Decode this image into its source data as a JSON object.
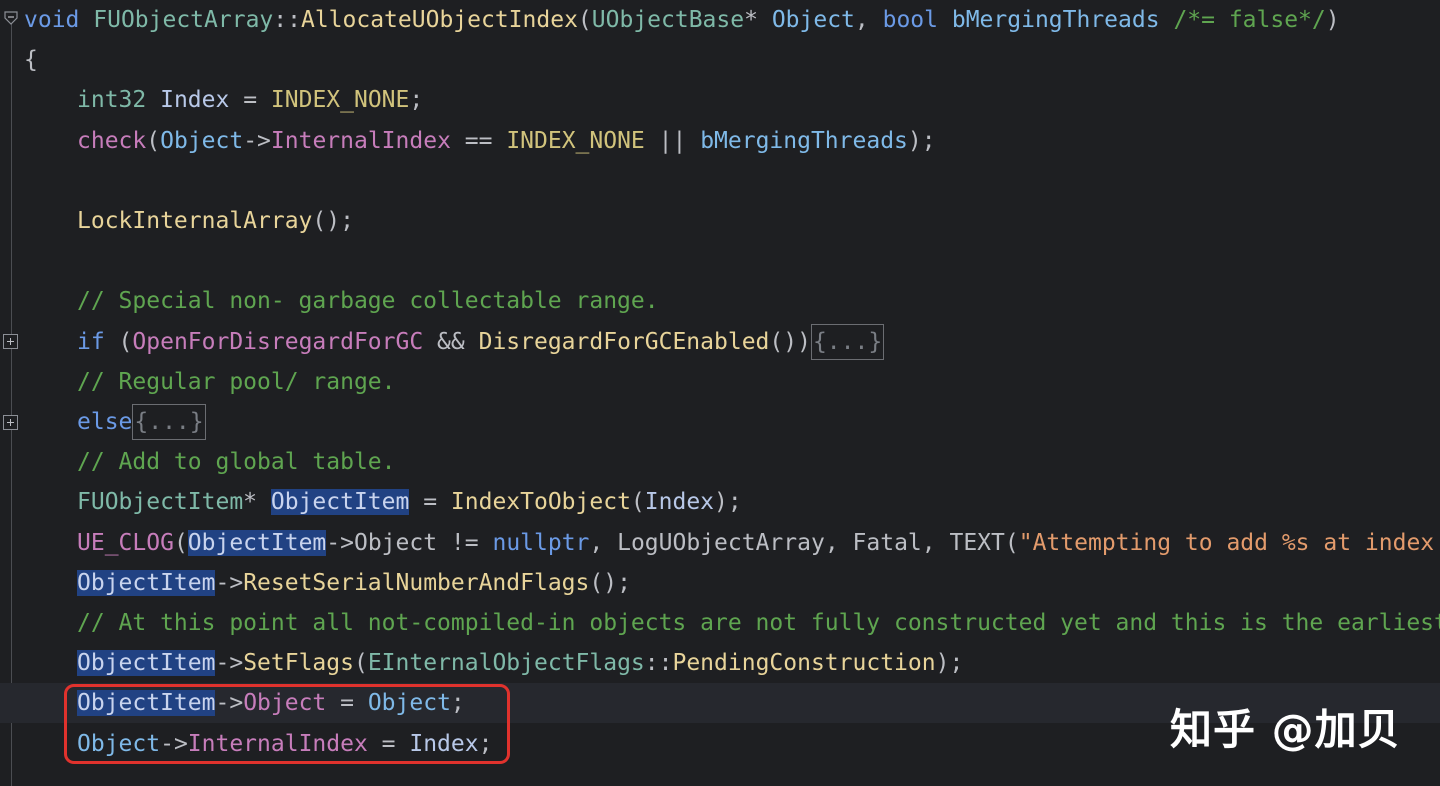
{
  "editor": {
    "lines": [
      {
        "parts": [
          [
            "void",
            "kwb"
          ],
          [
            " ",
            "op"
          ],
          [
            "FUObjectArray",
            "cls"
          ],
          [
            "::",
            "op"
          ],
          [
            "AllocateUObjectIndex",
            "fnc"
          ],
          [
            "(",
            "op"
          ],
          [
            "UObjectBase",
            "ty"
          ],
          [
            "* ",
            "op"
          ],
          [
            "Object",
            "par"
          ],
          [
            ", ",
            "op"
          ],
          [
            "bool",
            "kwb"
          ],
          [
            " ",
            "op"
          ],
          [
            "bMergingThreads",
            "par"
          ],
          [
            " ",
            "op"
          ],
          [
            "/*= false*/",
            "cmt"
          ],
          [
            ")",
            "op"
          ]
        ]
      },
      {
        "parts": [
          [
            "{",
            "op"
          ]
        ]
      },
      {
        "parts": [
          [
            "int32",
            "ty"
          ],
          [
            " ",
            "op"
          ],
          [
            "Index",
            "var"
          ],
          [
            " = ",
            "op"
          ],
          [
            "INDEX_NONE",
            "fnm"
          ],
          [
            ";",
            "op"
          ]
        ]
      },
      {
        "parts": [
          [
            "check",
            "mac"
          ],
          [
            "(",
            "op"
          ],
          [
            "Object",
            "par"
          ],
          [
            "->",
            "op"
          ],
          [
            "InternalIndex",
            "fld"
          ],
          [
            " == ",
            "op"
          ],
          [
            "INDEX_NONE",
            "fnm"
          ],
          [
            " || ",
            "op"
          ],
          [
            "bMergingThreads",
            "par"
          ],
          [
            ");",
            "op"
          ]
        ]
      },
      {
        "parts": []
      },
      {
        "parts": [
          [
            "LockInternalArray",
            "fnc"
          ],
          [
            "();",
            "op"
          ]
        ]
      },
      {
        "parts": []
      },
      {
        "parts": [
          [
            "// Special non- garbage collectable range.",
            "cmt"
          ]
        ]
      },
      {
        "parts": [
          [
            "if",
            "kwb"
          ],
          [
            " (",
            "op"
          ],
          [
            "OpenForDisregardForGC",
            "fld"
          ],
          [
            " && ",
            "op"
          ],
          [
            "DisregardForGCEnabled",
            "fnc"
          ],
          [
            "())",
            "op"
          ],
          [
            "{...}",
            "collapsed"
          ]
        ]
      },
      {
        "parts": [
          [
            "// Regular pool/ range.",
            "cmt"
          ]
        ]
      },
      {
        "parts": [
          [
            "else",
            "kwb"
          ],
          [
            "{...}",
            "collapsed"
          ]
        ]
      },
      {
        "parts": [
          [
            "// Add to global table.",
            "cmt"
          ]
        ]
      },
      {
        "parts": [
          [
            "FUObjectItem",
            "cls"
          ],
          [
            "* ",
            "op"
          ],
          [
            "ObjectItem",
            "hl"
          ],
          [
            " = ",
            "op"
          ],
          [
            "IndexToObject",
            "fnc"
          ],
          [
            "(",
            "op"
          ],
          [
            "Index",
            "var"
          ],
          [
            ");",
            "op"
          ]
        ]
      },
      {
        "parts": [
          [
            "UE_CLOG",
            "mac"
          ],
          [
            "(",
            "op"
          ],
          [
            "ObjectItem",
            "hl"
          ],
          [
            "->",
            "op"
          ],
          [
            "Object",
            "op"
          ],
          [
            " != ",
            "op"
          ],
          [
            "nullptr",
            "kwb"
          ],
          [
            ", ",
            "op"
          ],
          [
            "LogUObjectArray",
            "op"
          ],
          [
            ", ",
            "op"
          ],
          [
            "Fatal",
            "op"
          ],
          [
            ", ",
            "op"
          ],
          [
            "TEXT",
            "op"
          ],
          [
            "(",
            "op"
          ],
          [
            "\"Attempting to add %s at index %d",
            "str"
          ]
        ]
      },
      {
        "parts": [
          [
            "ObjectItem",
            "hl"
          ],
          [
            "->",
            "op"
          ],
          [
            "ResetSerialNumberAndFlags",
            "fnc"
          ],
          [
            "();",
            "op"
          ]
        ]
      },
      {
        "parts": [
          [
            "// At this point all not-compiled-in objects are not fully constructed yet and this is the earliest we",
            "cmt"
          ]
        ]
      },
      {
        "parts": [
          [
            "ObjectItem",
            "hl"
          ],
          [
            "->",
            "op"
          ],
          [
            "SetFlags",
            "fnc"
          ],
          [
            "(",
            "op"
          ],
          [
            "EInternalObjectFlags",
            "cls"
          ],
          [
            "::",
            "op"
          ],
          [
            "PendingConstruction",
            "fnc"
          ],
          [
            ");",
            "op"
          ]
        ]
      },
      {
        "parts": [
          [
            "ObjectItem",
            "hl"
          ],
          [
            "->",
            "op"
          ],
          [
            "Object",
            "fld"
          ],
          [
            " = ",
            "op"
          ],
          [
            "Object",
            "par"
          ],
          [
            ";",
            "op"
          ]
        ]
      },
      {
        "parts": [
          [
            "Object",
            "par"
          ],
          [
            "->",
            "op"
          ],
          [
            "InternalIndex",
            "fld"
          ],
          [
            " = ",
            "op"
          ],
          [
            "Index",
            "var"
          ],
          [
            ";",
            "op"
          ]
        ]
      }
    ]
  },
  "watermark": {
    "text": "知乎 @加贝"
  },
  "icons": {
    "fold_open": "fold-open-icon",
    "fold_collapsed": "fold-expand-icon"
  },
  "colors": {
    "background": "#1e1f22",
    "highlight_box": "#e0322d",
    "selection": "#214283"
  }
}
